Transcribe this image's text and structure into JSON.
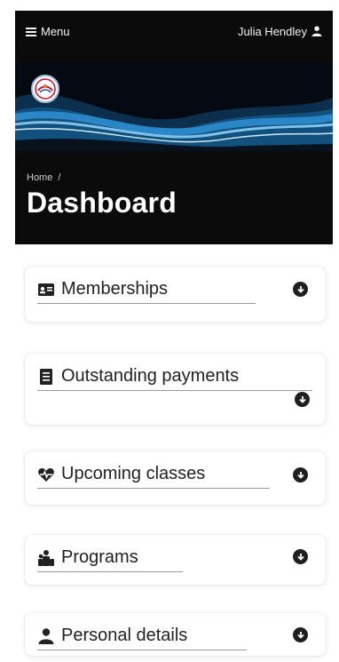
{
  "topbar": {
    "menu_label": "Menu",
    "user_name": "Julia Hendley"
  },
  "hero": {
    "breadcrumb_home": "Home",
    "breadcrumb_sep": "/",
    "title": "Dashboard"
  },
  "sections": [
    {
      "label": "Memberships",
      "icon": "id-card-icon"
    },
    {
      "label": "Outstanding payments",
      "icon": "receipt-icon"
    },
    {
      "label": "Upcoming classes",
      "icon": "heartbeat-icon"
    },
    {
      "label": "Programs",
      "icon": "people-icon"
    },
    {
      "label": "Personal details",
      "icon": "user-icon"
    }
  ],
  "colors": {
    "header_bg": "#0b0b0b",
    "wave_blue": "#2a86c7",
    "text_dark": "#222222"
  }
}
